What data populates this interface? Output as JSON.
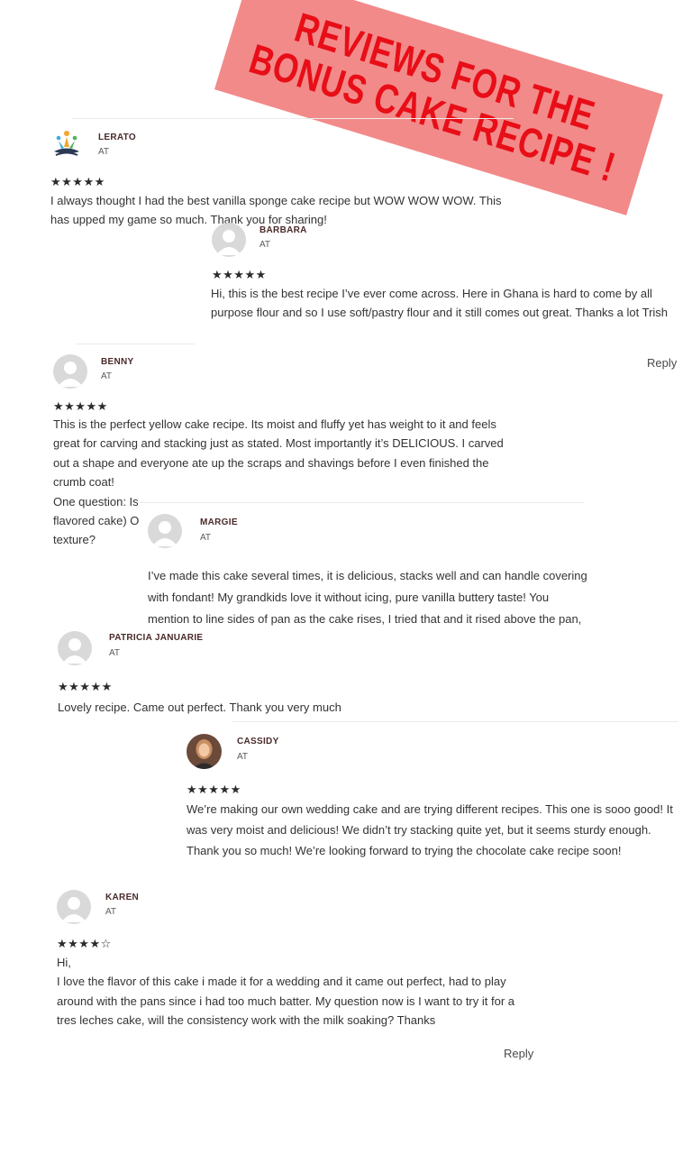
{
  "banner": {
    "line1": "REVIEWS FOR THE",
    "line2": "BONUS CAKE RECIPE !"
  },
  "colors": {
    "banner_bg": "#f28a8a",
    "banner_text": "#e80e17",
    "name": "#4a2a2a"
  },
  "reviews": [
    {
      "name": "LERATO",
      "at": "AT",
      "stars": "★★★★★",
      "text": "I always thought I had the best vanilla sponge cake recipe but WOW WOW WOW. This has upped my game so much. Thank you for sharing!"
    },
    {
      "name": "BARBARA",
      "at": "AT",
      "stars": "★★★★★",
      "text": "Hi, this is the best recipe I’ve ever come across. Here in Ghana is hard to come by all purpose flour and so I use soft/pastry flour and it still comes out great. Thanks a lot Trish"
    },
    {
      "name": "BENNY",
      "at": "AT",
      "stars": "★★★★★",
      "reply": "Reply",
      "text": "This is the perfect yellow cake recipe. Its moist and fluffy yet has weight to it and feels great for carving and stacking just as stated. Most importantly it’s DELICIOUS. I carved out a shape and everyone ate up the scraps and shavings before I even finished the crumb coat!",
      "q1": "One question: Is",
      "q2": "flavored cake) Or",
      "q3": "texture?"
    },
    {
      "name": "MARGIE",
      "at": "AT",
      "text": "I’ve made this cake several times, it is delicious, stacks well and can handle covering with fondant! My grandkids love it without icing, pure vanilla buttery taste! You mention to line sides of pan as the cake rises, I tried that and it rised above the pan, so I used parchment on the sides."
    },
    {
      "name": "PATRICIA JANUARIE",
      "at": "AT",
      "stars": "★★★★★",
      "text": "Lovely recipe. Came out perfect. Thank you very much"
    },
    {
      "name": "CASSIDY",
      "at": "AT",
      "stars": "★★★★★",
      "text": "We’re making our own wedding cake and are trying different recipes. This one is sooo good! It was very moist and delicious! We didn’t try stacking quite yet, but it seems sturdy enough. Thank you so much! We’re looking forward to trying the chocolate cake recipe soon!"
    },
    {
      "name": "KAREN",
      "at": "AT",
      "stars": "★★★★☆",
      "reply": "Reply",
      "greeting": "Hi,",
      "text": "I love the flavor of this cake i made it for a wedding and it came out perfect, had to play around with the pans since i had too much batter. My question now is I want to try it for a tres leches cake, will the consistency work with the milk soaking? Thanks"
    }
  ]
}
